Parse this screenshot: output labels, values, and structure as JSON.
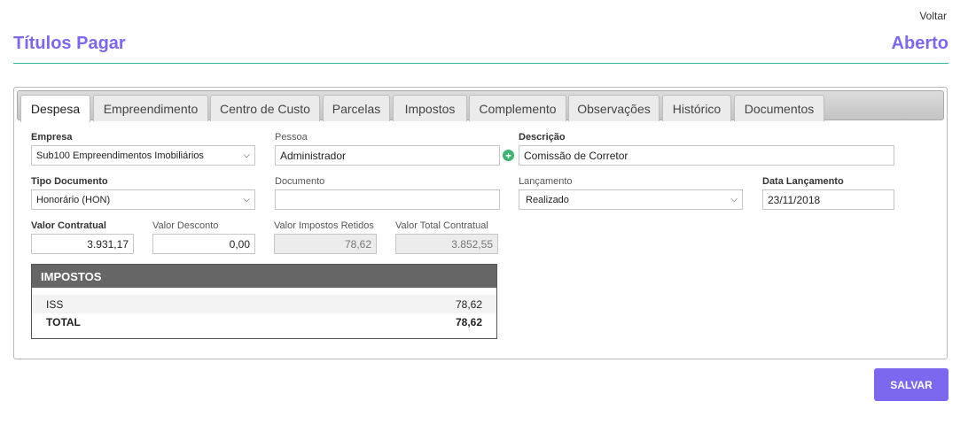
{
  "header": {
    "back_label": "Voltar",
    "title": "Títulos Pagar",
    "status": "Aberto"
  },
  "tabs": [
    {
      "label": "Despesa",
      "active": true
    },
    {
      "label": "Empreendimento"
    },
    {
      "label": "Centro de Custo"
    },
    {
      "label": "Parcelas"
    },
    {
      "label": "Impostos"
    },
    {
      "label": "Complemento"
    },
    {
      "label": "Observações"
    },
    {
      "label": "Histórico"
    },
    {
      "label": "Documentos"
    }
  ],
  "form": {
    "empresa": {
      "label": "Empresa",
      "value": "Sub100 Empreendimentos Imobiliários"
    },
    "pessoa": {
      "label": "Pessoa",
      "value": "Administrador"
    },
    "descricao": {
      "label": "Descrição",
      "value": "Comissão de Corretor"
    },
    "tipo_documento": {
      "label": "Tipo Documento",
      "value": "Honorário (HON)"
    },
    "documento": {
      "label": "Documento",
      "value": ""
    },
    "lancamento": {
      "label": "Lançamento",
      "value": "Realizado"
    },
    "data_lancamento": {
      "label": "Data Lançamento",
      "value": "23/11/2018"
    },
    "valor_contratual": {
      "label": "Valor Contratual",
      "value": "3.931,17"
    },
    "valor_desconto": {
      "label": "Valor Desconto",
      "value": "0,00"
    },
    "valor_impostos_retidos": {
      "label": "Valor Impostos Retidos",
      "value": "78,62"
    },
    "valor_total_contratual": {
      "label": "Valor Total Contratual",
      "value": "3.852,55"
    }
  },
  "impostos": {
    "title": "IMPOSTOS",
    "rows": [
      {
        "name": "ISS",
        "value": "78,62"
      },
      {
        "name": "TOTAL",
        "value": "78,62"
      }
    ]
  },
  "actions": {
    "save_label": "SALVAR"
  },
  "colors": {
    "accent": "#7b68ee",
    "divider": "#2fb99e",
    "add": "#3cb371"
  }
}
